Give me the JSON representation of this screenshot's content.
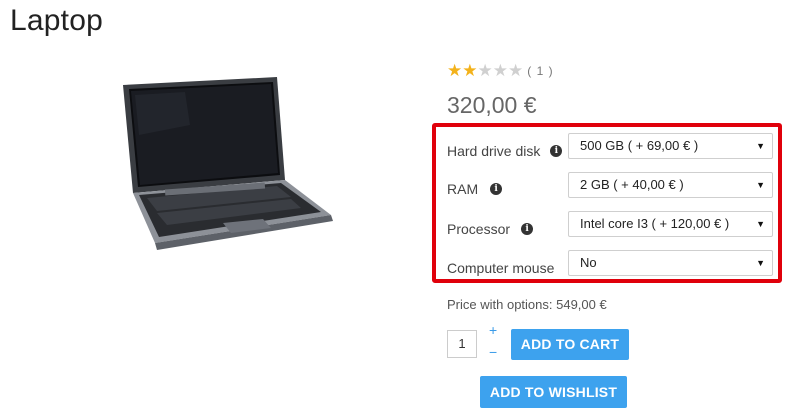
{
  "product": {
    "title": "Laptop",
    "price": "320,00 €",
    "rating": {
      "value": 2,
      "max": 5,
      "count_text": "( 1 )"
    }
  },
  "options": [
    {
      "label": "Hard drive disk",
      "has_info_icon": true,
      "selected": "500 GB ( + 69,00 € )"
    },
    {
      "label": "RAM",
      "has_info_icon": true,
      "selected": "2 GB ( + 40,00 € )"
    },
    {
      "label": "Processor",
      "has_info_icon": true,
      "selected": "Intel core I3 ( + 120,00 € )"
    },
    {
      "label": "Computer mouse",
      "has_info_icon": false,
      "selected": "No"
    }
  ],
  "price_with_options": "Price with options: 549,00 €",
  "quantity": {
    "value": "1",
    "plus": "+",
    "minus": "−"
  },
  "buttons": {
    "add_to_cart": "ADD TO CART",
    "add_to_wishlist": "ADD TO WISHLIST"
  },
  "icons": {
    "star": "star-icon",
    "info": "info-icon",
    "dropdown": "chevron-down-icon"
  },
  "colors": {
    "accent": "#3da2ee",
    "highlight_border": "#e0000b",
    "star": "#f3b21b"
  }
}
